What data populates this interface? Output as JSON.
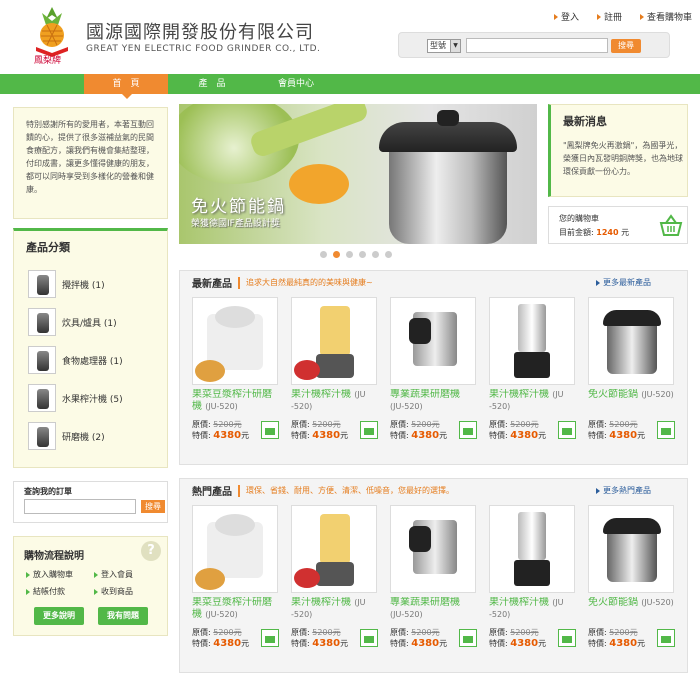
{
  "brand": {
    "logo_text": "鳳梨牌",
    "name_cn": "國源國際開發股份有限公司",
    "name_en": "GREAT YEN ELECTRIC FOOD GRINDER CO., LTD."
  },
  "toplinks": [
    "登入",
    "註冊",
    "查看購物車"
  ],
  "search": {
    "select_value": "型號",
    "button": "搜尋"
  },
  "nav": [
    "首　頁",
    "產　品",
    "會員中心"
  ],
  "intro": "特別感謝所有的愛用者，本著互動回饋的心，提供了很多滋補益氣的民間食療配方，讓我們有機會集結整理，付印成書，讓更多懂得健康的朋友，都可以同時享受到多樣化的營養和健康。",
  "banner": {
    "title": "免火節能鍋",
    "subtitle": "榮獲德國IF產品設計獎"
  },
  "news": {
    "title": "最新消息",
    "text": "\"鳳梨牌免火再激鍋\"，為國爭光，榮獲日內瓦發明銅牌獎，也為地球環保貢獻一份心力。"
  },
  "cart": {
    "label": "您的購物車",
    "amount_label": "目前金額:",
    "amount": "1240",
    "unit": "元"
  },
  "categories": {
    "title": "產品分類",
    "items": [
      {
        "label": "攪拌機 (1)"
      },
      {
        "label": "炊具/爐具 (1)"
      },
      {
        "label": "食物處理器 (1)"
      },
      {
        "label": "水果榨汁機 (5)"
      },
      {
        "label": "研磨機 (2)"
      }
    ]
  },
  "order": {
    "title": "查詢我的訂單",
    "button": "搜尋"
  },
  "flow": {
    "title": "購物流程說明",
    "links": [
      "放入購物車",
      "登入會員",
      "結帳付款",
      "收到商品"
    ],
    "btn_more": "更多說明",
    "btn_ask": "我有問題"
  },
  "new_products": {
    "title": "最新產品",
    "slogan": "追求大自然最純真的的美味與健康~",
    "more": "更多最新產品",
    "items": [
      {
        "name": "果菜豆漿榨汁研磨機",
        "code": "(JU-520)",
        "orig": "原價: ",
        "orig_val": "5200元",
        "sale": "特價: ",
        "sale_val": "4380",
        "unit": "元"
      },
      {
        "name": "果汁機榨汁機",
        "code": "(JU -520)",
        "orig": "原價: ",
        "orig_val": "5200元",
        "sale": "特價: ",
        "sale_val": "4380",
        "unit": "元"
      },
      {
        "name": "專業蔬果研磨機",
        "code": "(JU-520)",
        "orig": "原價: ",
        "orig_val": "5200元",
        "sale": "特價: ",
        "sale_val": "4380",
        "unit": "元"
      },
      {
        "name": "果汁機榨汁機",
        "code": "(JU -520)",
        "orig": "原價: ",
        "orig_val": "5200元",
        "sale": "特價: ",
        "sale_val": "4380",
        "unit": "元"
      },
      {
        "name": "免火節能鍋",
        "code": "(JU-520)",
        "orig": "原價: ",
        "orig_val": "5200元",
        "sale": "特價: ",
        "sale_val": "4380",
        "unit": "元"
      }
    ]
  },
  "hot_products": {
    "title": "熱門產品",
    "slogan": "環保、省錢、耐用、方便、清潔、低噪音，您最好的選擇。",
    "more": "更多熱門產品",
    "items": [
      {
        "name": "果菜豆漿榨汁研磨機",
        "code": "(JU-520)",
        "orig": "原價: ",
        "orig_val": "5200元",
        "sale": "特價: ",
        "sale_val": "4380",
        "unit": "元"
      },
      {
        "name": "果汁機榨汁機",
        "code": "(JU -520)",
        "orig": "原價: ",
        "orig_val": "5200元",
        "sale": "特價: ",
        "sale_val": "4380",
        "unit": "元"
      },
      {
        "name": "專業蔬果研磨機",
        "code": "(JU-520)",
        "orig": "原價: ",
        "orig_val": "5200元",
        "sale": "特價: ",
        "sale_val": "4380",
        "unit": "元"
      },
      {
        "name": "果汁機榨汁機",
        "code": "(JU -520)",
        "orig": "原價: ",
        "orig_val": "5200元",
        "sale": "特價: ",
        "sale_val": "4380",
        "unit": "元"
      },
      {
        "name": "免火節能鍋",
        "code": "(JU-520)",
        "orig": "原價: ",
        "orig_val": "5200元",
        "sale": "特價: ",
        "sale_val": "4380",
        "unit": "元"
      }
    ]
  },
  "colors": {
    "green": "#52b848",
    "orange": "#f08a30",
    "price": "#e65a00",
    "link": "#2b5d9b"
  }
}
